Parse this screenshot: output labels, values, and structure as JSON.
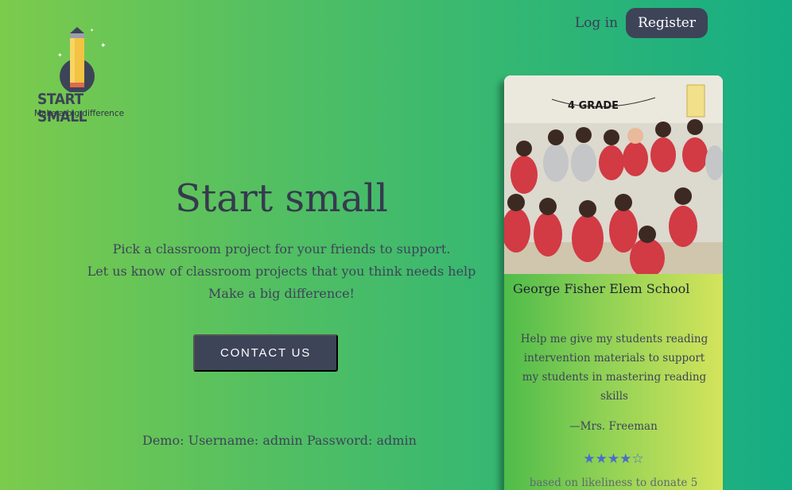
{
  "brand": {
    "title": "START SMALL",
    "tagline": "Make a big difference"
  },
  "nav": {
    "login": "Log in",
    "register": "Register"
  },
  "hero": {
    "title": "Start small",
    "lines": [
      "Pick a classroom project for your friends to support.",
      "Let us know of classroom projects that you think needs help",
      "Make a big difference!"
    ],
    "cta": "CONTACT US",
    "demo": "Demo: Username: admin Password: admin"
  },
  "card": {
    "banner": "4 GRADE",
    "school": "George Fisher Elem School",
    "quote": "Help me give my students reading intervention materials to support my students in mastering reading skills",
    "author": "—Mrs. Freeman",
    "rating": {
      "value": 4,
      "max": 5,
      "filled_glyph": "★",
      "empty_glyph": "☆"
    },
    "rating_note": "based on likeliness to donate 5"
  },
  "colors": {
    "accent": "#3d4458",
    "star": "#4a6ec8"
  },
  "icons": {
    "logo": "pencil-rocket-icon"
  }
}
